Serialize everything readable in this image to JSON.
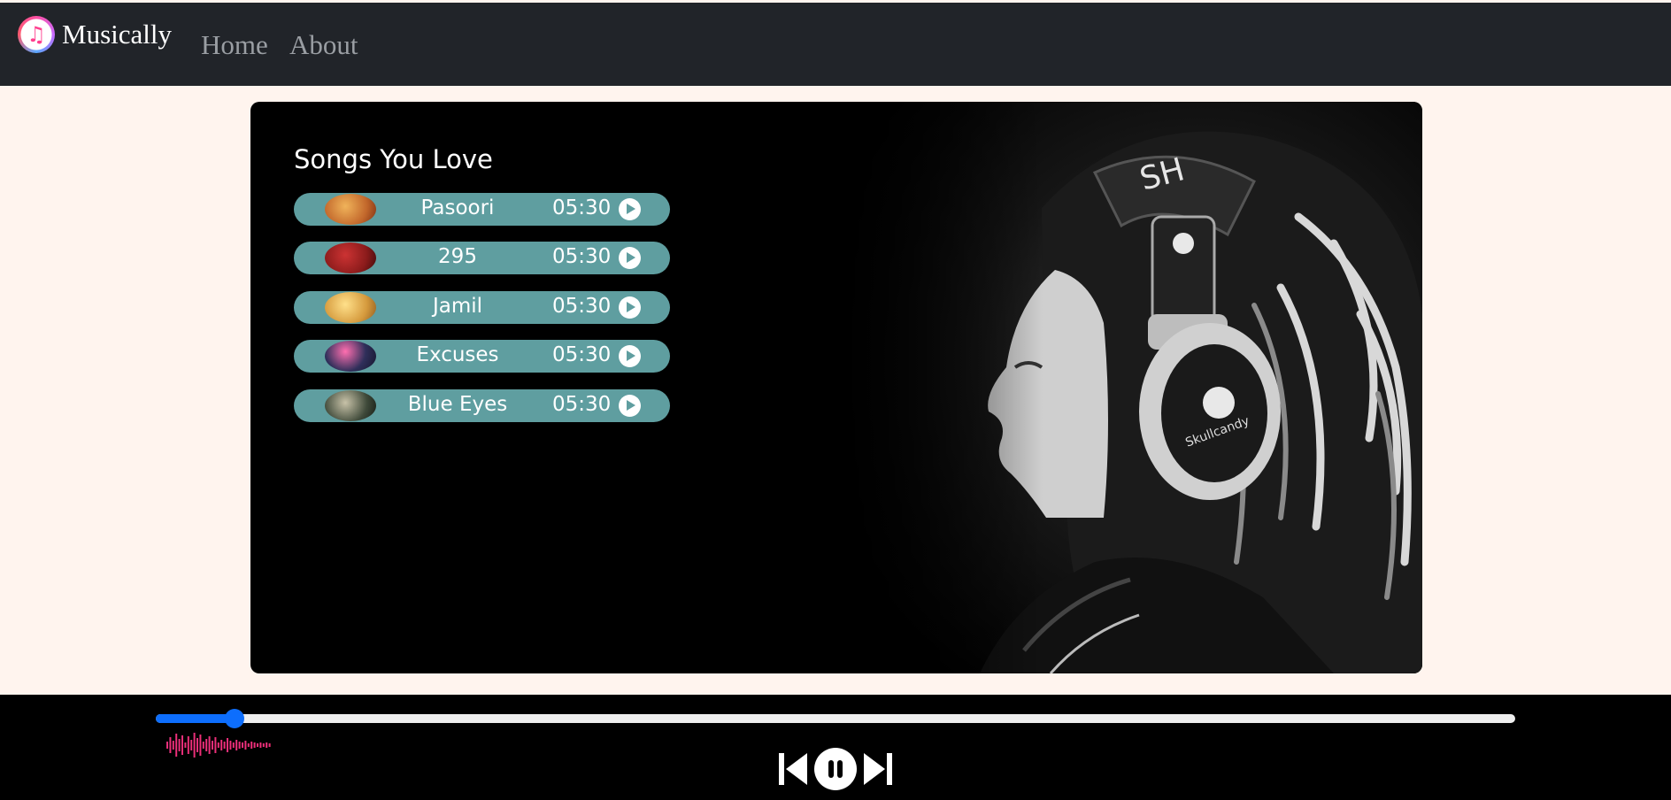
{
  "nav": {
    "brand": "Musically",
    "logo_icon": "music-note-icon",
    "links": [
      {
        "label": "Home"
      },
      {
        "label": "About"
      }
    ]
  },
  "library": {
    "title": "Songs You Love",
    "songs": [
      {
        "name": "Pasoori",
        "duration": "05:30",
        "cover_color": "#c2672b"
      },
      {
        "name": "295",
        "duration": "05:30",
        "cover_color": "#8b1b1b"
      },
      {
        "name": "Jamil",
        "duration": "05:30",
        "cover_color": "#d59a3d"
      },
      {
        "name": "Excuses",
        "duration": "05:30",
        "cover_color": "#2f2f5a"
      },
      {
        "name": "Blue Eyes",
        "duration": "05:30",
        "cover_color": "#3f4a3a"
      }
    ]
  },
  "player": {
    "progress_fraction": 0.058,
    "is_playing": true,
    "controls": [
      "previous-icon",
      "pause-icon",
      "next-icon"
    ]
  },
  "colors": {
    "navbar": "#212429",
    "page_bg": "#fff4ee",
    "song_pill": "#5f9ea0",
    "progress": "#0d6efd",
    "wave_start": "#d63384",
    "wave_end": "#ff2a6d"
  }
}
